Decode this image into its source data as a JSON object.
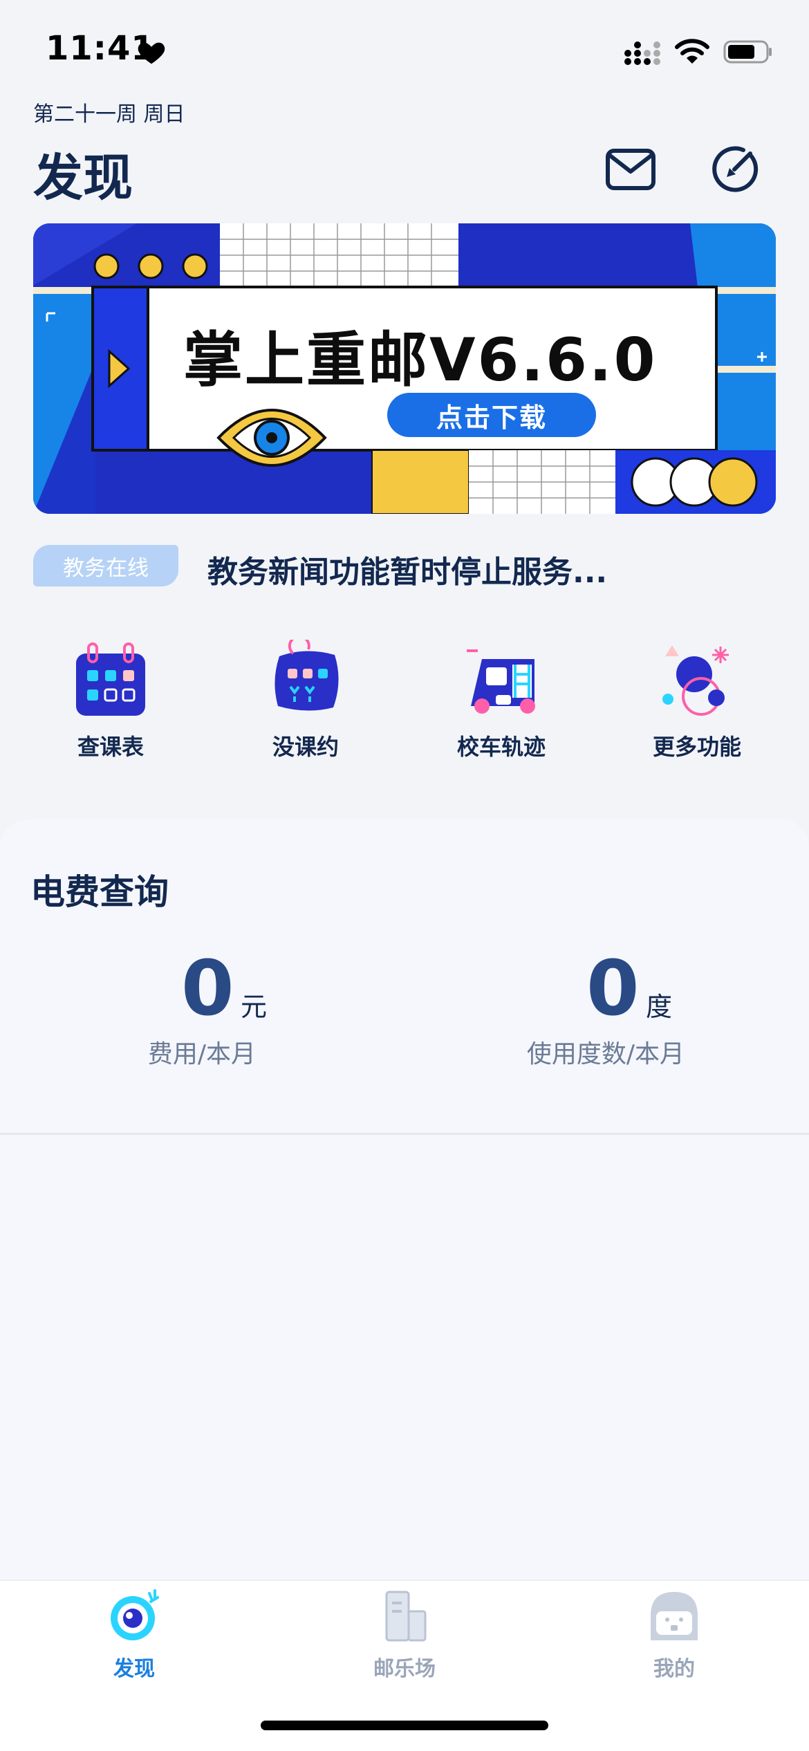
{
  "status_bar": {
    "time": "11:41"
  },
  "header": {
    "week_label": "第二十一周 周日",
    "title": "发现"
  },
  "banner": {
    "title": "掌上重邮V6.6.0",
    "button_label": "点击下载"
  },
  "notice": {
    "tag": "教务在线",
    "text": "教务新闻功能暂时停止服务..."
  },
  "features": [
    {
      "label": "查课表",
      "icon": "calendar-icon"
    },
    {
      "label": "没课约",
      "icon": "free-time-icon"
    },
    {
      "label": "校车轨迹",
      "icon": "school-bus-icon"
    },
    {
      "label": "更多功能",
      "icon": "more-features-icon"
    }
  ],
  "electricity": {
    "title": "电费查询",
    "cost": {
      "value": "0",
      "unit": "元",
      "label": "费用/本月"
    },
    "usage": {
      "value": "0",
      "unit": "度",
      "label": "使用度数/本月"
    }
  },
  "tab_bar": {
    "tabs": [
      {
        "label": "发现",
        "icon": "discover-icon",
        "active": true
      },
      {
        "label": "邮乐场",
        "icon": "playground-icon",
        "active": false
      },
      {
        "label": "我的",
        "icon": "profile-icon",
        "active": false
      }
    ]
  },
  "colors": {
    "title": "#13284f",
    "accent": "#1a7fe0",
    "banner_blue": "#1e2fc2",
    "banner_yellow": "#f5c842",
    "tag_bg": "#b6d2f6",
    "inactive": "#9aa5b8"
  }
}
